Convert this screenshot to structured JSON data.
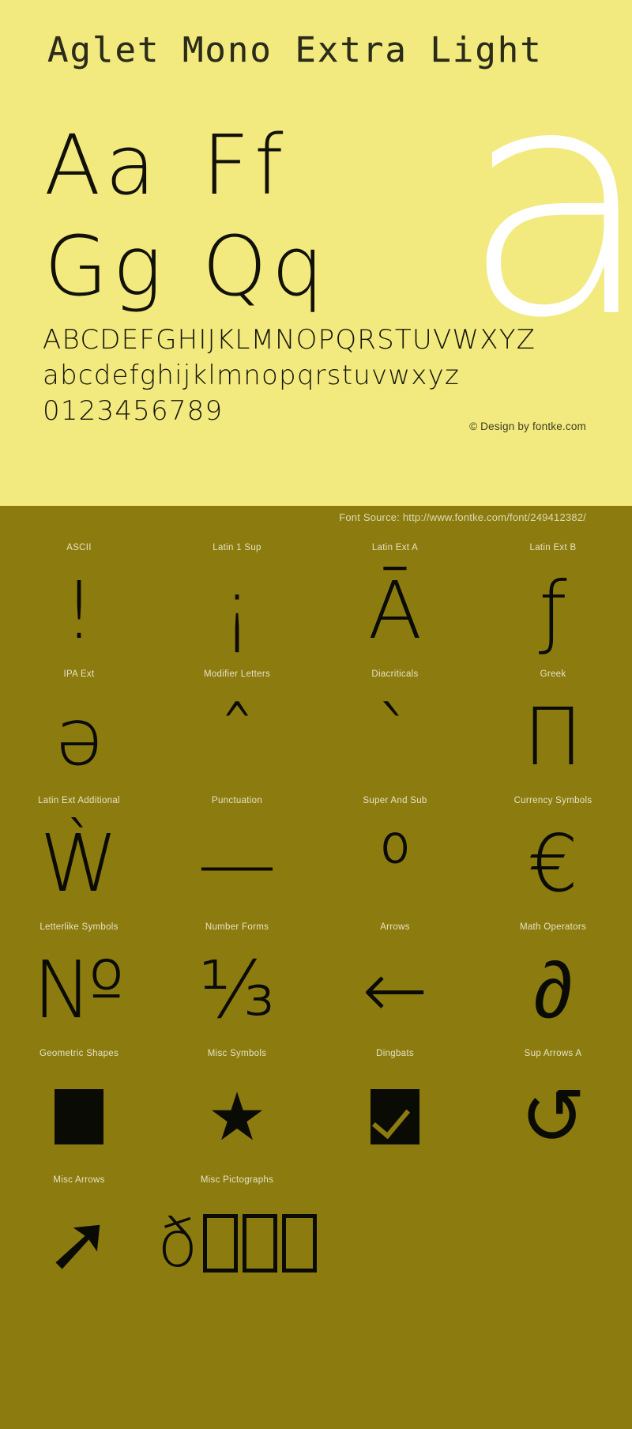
{
  "specimen": {
    "title": "Aglet Mono Extra Light",
    "giant_letter": "a",
    "pairs": [
      "Aa",
      "Ff",
      "Gg",
      "Qq"
    ],
    "alphabet_upper": "ABCDEFGHIJKLMNOPQRSTUVWXYZ",
    "alphabet_lower": "abcdefghijklmnopqrstuvwxyz",
    "digits": "0123456789",
    "copyright": "© Design by fontke.com",
    "source": "Font Source: http://www.fontke.com/font/249412382/",
    "colors": {
      "top_background": "#f2ea7f",
      "bottom_background": "#8c7c10",
      "glyph_ink": "#0b0b05",
      "label_text": "#e6e2c4",
      "giant_letter": "#ffffff",
      "title_text": "#2b2b1a"
    }
  },
  "blocks": [
    {
      "label": "ASCII",
      "glyph": "!",
      "style": "big"
    },
    {
      "label": "Latin 1 Sup",
      "glyph": "¡",
      "style": "big"
    },
    {
      "label": "Latin Ext A",
      "glyph": "Ā",
      "style": "big"
    },
    {
      "label": "Latin Ext B",
      "glyph": "ƒ",
      "style": "big"
    },
    {
      "label": "IPA Ext",
      "glyph": "ǝ",
      "style": "big"
    },
    {
      "label": "Modifier Letters",
      "glyph": "ˆ",
      "style": "big"
    },
    {
      "label": "Diacriticals",
      "glyph": "ˋ",
      "style": "big"
    },
    {
      "label": "Greek",
      "glyph": "Π",
      "style": "big"
    },
    {
      "label": "Latin Ext Additional",
      "glyph": "Ẁ",
      "style": "big"
    },
    {
      "label": "Punctuation",
      "glyph": "—",
      "style": "big"
    },
    {
      "label": "Super And Sub",
      "glyph": "⁰",
      "style": "big"
    },
    {
      "label": "Currency Symbols",
      "glyph": "€",
      "style": "big"
    },
    {
      "label": "Letterlike Symbols",
      "glyph": "№",
      "style": "big"
    },
    {
      "label": "Number Forms",
      "glyph": "⅓",
      "style": "big"
    },
    {
      "label": "Arrows",
      "glyph": "←",
      "style": "big"
    },
    {
      "label": "Math Operators",
      "glyph": "∂",
      "style": "big"
    },
    {
      "label": "Geometric Shapes",
      "glyph": "■",
      "style": "shape-square"
    },
    {
      "label": "Misc Symbols",
      "glyph": "★",
      "style": "filled"
    },
    {
      "label": "Dingbats",
      "glyph": "☑",
      "style": "shape-ballot"
    },
    {
      "label": "Sup Arrows A",
      "glyph": "↺",
      "style": "big"
    },
    {
      "label": "Misc Arrows",
      "glyph": "➚",
      "style": "big"
    },
    {
      "label": "Misc Pictographs",
      "glyph": "ð□□□",
      "style": "shape-tofu"
    },
    {
      "label": "",
      "glyph": "",
      "style": "empty"
    },
    {
      "label": "",
      "glyph": "",
      "style": "empty"
    }
  ]
}
